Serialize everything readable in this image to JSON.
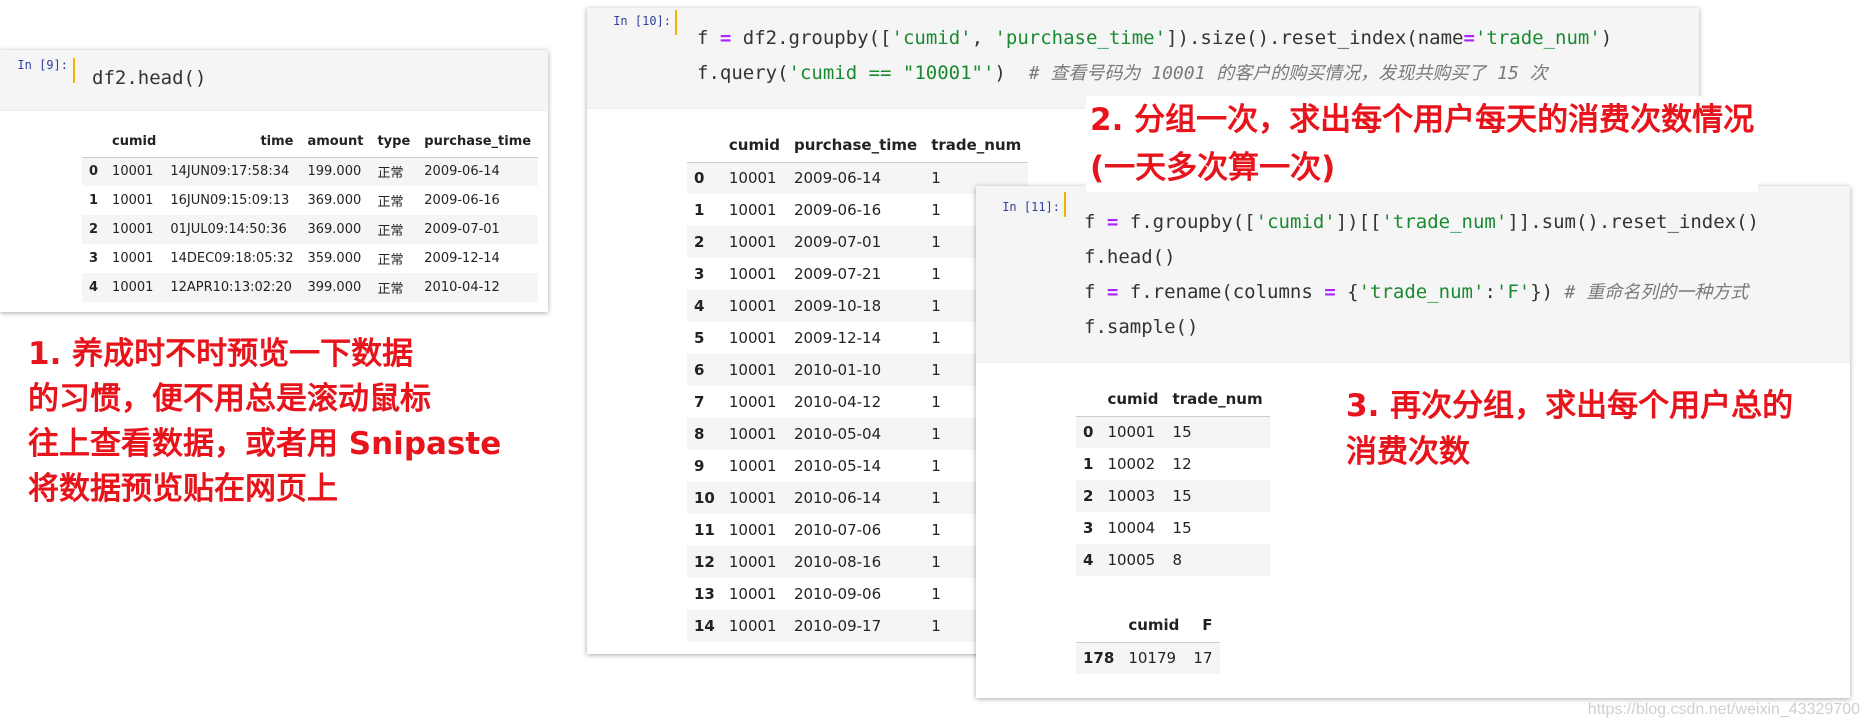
{
  "cell9": {
    "prompt": "In [9]:",
    "code": "df2.head()",
    "columns": [
      "",
      "cumid",
      "time",
      "amount",
      "type",
      "purchase_time"
    ],
    "rows": [
      [
        "0",
        "10001",
        "14JUN09:17:58:34",
        "199.000",
        "正常",
        "2009-06-14"
      ],
      [
        "1",
        "10001",
        "16JUN09:15:09:13",
        "369.000",
        "正常",
        "2009-06-16"
      ],
      [
        "2",
        "10001",
        "01JUL09:14:50:36",
        "369.000",
        "正常",
        "2009-07-01"
      ],
      [
        "3",
        "10001",
        "14DEC09:18:05:32",
        "359.000",
        "正常",
        "2009-12-14"
      ],
      [
        "4",
        "10001",
        "12APR10:13:02:20",
        "399.000",
        "正常",
        "2010-04-12"
      ]
    ]
  },
  "cell10": {
    "prompt": "In [10]:",
    "line1": {
      "a": "f ",
      "op": "=",
      "b": " df2.groupby([",
      "s1": "'cumid'",
      "c": ", ",
      "s2": "'purchase_time'",
      "d": "]).size().reset_index(name",
      "op2": "=",
      "s3": "'trade_num'",
      "e": ")"
    },
    "line2": {
      "a": "f.query(",
      "s1": "'cumid == \"10001\"'",
      "b": ")  ",
      "comment": "# 查看号码为 10001 的客户的购买情况，发现共购买了 15 次"
    },
    "columns": [
      "",
      "cumid",
      "purchase_time",
      "trade_num"
    ],
    "rows": [
      [
        "0",
        "10001",
        "2009-06-14",
        "1"
      ],
      [
        "1",
        "10001",
        "2009-06-16",
        "1"
      ],
      [
        "2",
        "10001",
        "2009-07-01",
        "1"
      ],
      [
        "3",
        "10001",
        "2009-07-21",
        "1"
      ],
      [
        "4",
        "10001",
        "2009-10-18",
        "1"
      ],
      [
        "5",
        "10001",
        "2009-12-14",
        "1"
      ],
      [
        "6",
        "10001",
        "2010-01-10",
        "1"
      ],
      [
        "7",
        "10001",
        "2010-04-12",
        "1"
      ],
      [
        "8",
        "10001",
        "2010-05-04",
        "1"
      ],
      [
        "9",
        "10001",
        "2010-05-14",
        "1"
      ],
      [
        "10",
        "10001",
        "2010-06-14",
        "1"
      ],
      [
        "11",
        "10001",
        "2010-07-06",
        "1"
      ],
      [
        "12",
        "10001",
        "2010-08-16",
        "1"
      ],
      [
        "13",
        "10001",
        "2010-09-06",
        "1"
      ],
      [
        "14",
        "10001",
        "2010-09-17",
        "1"
      ]
    ]
  },
  "cell11": {
    "prompt": "In [11]:",
    "line1": {
      "a": "f ",
      "op": "=",
      "b": " f.groupby([",
      "s1": "'cumid'",
      "c": "])[[",
      "s2": "'trade_num'",
      "d": "]].sum().reset_index()"
    },
    "line2": "f.head()",
    "line3": {
      "a": "f ",
      "op": "=",
      "b": " f.rename(columns ",
      "op2": "=",
      "c": " {",
      "s1": "'trade_num'",
      "d": ":",
      "s2": "'F'",
      "e": "}) ",
      "comment": "# 重命名列的一种方式"
    },
    "line4": "f.sample()",
    "table1": {
      "columns": [
        "",
        "cumid",
        "trade_num"
      ],
      "rows": [
        [
          "0",
          "10001",
          "15"
        ],
        [
          "1",
          "10002",
          "12"
        ],
        [
          "2",
          "10003",
          "15"
        ],
        [
          "3",
          "10004",
          "15"
        ],
        [
          "4",
          "10005",
          "8"
        ]
      ]
    },
    "table2": {
      "columns": [
        "",
        "cumid",
        "F"
      ],
      "rows": [
        [
          "178",
          "10179",
          "17"
        ]
      ]
    }
  },
  "annotations": {
    "note1": [
      "1. 养成时不时预览一下数据",
      "的习惯，便不用总是滚动鼠标",
      "往上查看数据，或者用 Snipaste",
      "将数据预览贴在网页上"
    ],
    "note2": [
      "2. 分组一次，求出每个用户每天的消费次数情况",
      "(一天多次算一次)"
    ],
    "note3": [
      "3. 再次分组，求出每个用户总的",
      "消费次数"
    ]
  },
  "watermark": "https://blog.csdn.net/weixin_43329700",
  "colors": {
    "annotation": "#e8141c",
    "string": "#1a8a30",
    "operator": "#aa22ff",
    "prompt": "#303f9f"
  }
}
